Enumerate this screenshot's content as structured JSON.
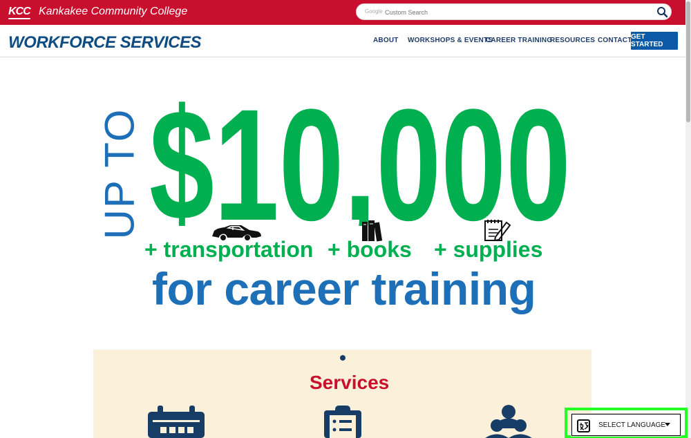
{
  "header": {
    "logo": "KCC",
    "college_name": "Kankakee Community College",
    "search": {
      "brand": "Google",
      "placeholder": "Custom Search",
      "value": ""
    },
    "brand_title": "WORKFORCE SERVICES",
    "nav": [
      "ABOUT",
      "WORKSHOPS & EVENTS",
      "CAREER TRAINING",
      "RESOURCES",
      "CONTACT"
    ],
    "cta": "GET STARTED",
    "colors": {
      "red": "#c8102e",
      "blue": "#0f4c81",
      "cta": "#0b5aa7"
    }
  },
  "hero": {
    "prefix": "UP TO",
    "amount": "$10,000",
    "extras": [
      "+ transportation",
      "+ books",
      "+ supplies"
    ],
    "line": "for career training",
    "colors": {
      "green": "#00b050",
      "blue": "#1d70b7"
    },
    "icons": [
      "car-icon",
      "books-icon",
      "notepad-icon"
    ]
  },
  "services": {
    "title": "Services",
    "icons": [
      "calendar-icon",
      "clipboard-icon",
      "people-icon"
    ]
  },
  "language": {
    "label": "SELECT LANGUAGE",
    "icons": [
      "translate-icon",
      "dropdown-caret-icon"
    ]
  }
}
